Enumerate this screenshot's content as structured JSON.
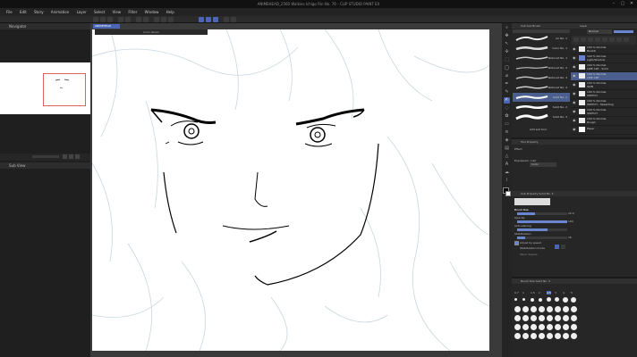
{
  "window": {
    "title": "ANIMEHEAD_2560 Walkies Ichigo Rin No. 76 - CLIP STUDIO PAINT EX",
    "controls": [
      "–",
      "▢",
      "✕"
    ]
  },
  "menu": [
    "File",
    "Edit",
    "Story",
    "Animation",
    "Layer",
    "Select",
    "View",
    "Filter",
    "Window",
    "Help"
  ],
  "left_panels": {
    "navigator_title": "Navigator",
    "subview_title": "Sub View"
  },
  "document": {
    "tab_label": "ANIMEHEAD",
    "float_label": "Color wheel"
  },
  "brush_panel": {
    "title": "Sub tool Brush",
    "items": [
      {
        "label": "Air No. 1"
      },
      {
        "label": "Color No. 1"
      },
      {
        "label": "Textured No. 1"
      },
      {
        "label": "Textured No. 2"
      },
      {
        "label": "Textured No. 3"
      },
      {
        "label": "Textured No. 4"
      },
      {
        "label": "Solid No. 1"
      },
      {
        "label": "Solid No. 2"
      },
      {
        "label": "Solid No. 3"
      }
    ],
    "add_label": "Add sub tool"
  },
  "layer_panel": {
    "title": "Layer",
    "blend_mode": "Normal",
    "layers": [
      {
        "name": "100 % Normal\nBLACK"
      },
      {
        "name": "100 % Normal\nLight/Shadow"
      },
      {
        "name": "100 % Normal\nLINE ART - Solid"
      },
      {
        "name": "100 % Normal\nLINE ART"
      },
      {
        "name": "100 % Normal\nSKIN"
      },
      {
        "name": "100 % Normal\nSKETCH"
      },
      {
        "name": "100 % Normal\nSKETCH - TweakImg"
      },
      {
        "name": "100 % Normal\nSKETCH"
      },
      {
        "name": "100 % Normal\nRough"
      },
      {
        "name": "Paper"
      }
    ]
  },
  "tool_property": {
    "title": "Tool Property",
    "effect_label": "Effect",
    "expression_label": "Expression color",
    "expression_value": "Color"
  },
  "sub_property": {
    "title": "Sub Property Solid No. 3",
    "rows": [
      {
        "label": "Brush Size",
        "value": "20.0",
        "fill": 0.35
      },
      {
        "label": "Opacity",
        "value": "100",
        "fill": 1.0
      },
      {
        "label": "Anti-aliasing",
        "value": "",
        "fill": 0.6
      },
      {
        "label": "Stabilization",
        "value": "16",
        "fill": 0.16
      }
    ],
    "adjust_label": "Adjust by speed",
    "stab_mode_label": "Stabilization mode",
    "taper_label": "Taper degree"
  },
  "brush_size_panel": {
    "title": "Brush Size Solid No. 3",
    "sizes": [
      "0.7",
      "1",
      "1.5",
      "2",
      "2.5",
      "3",
      "4",
      "5"
    ]
  },
  "colors": {
    "accent": "#4a66b5",
    "layer_selected": "#4b5f8f",
    "canvas": "#ffffff",
    "panel": "#262626"
  }
}
